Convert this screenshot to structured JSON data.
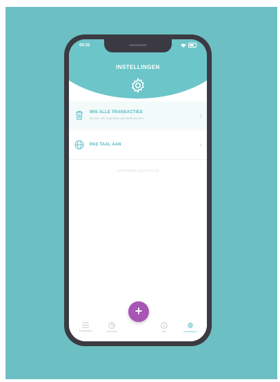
{
  "status_bar": {
    "time": "00:32"
  },
  "header": {
    "title": "INSTELLINGEN"
  },
  "settings": [
    {
      "title": "WIS ALLE TRANSACTIES",
      "subtitle": "Dit kan niet ongedaan gemaakt worden",
      "icon": "trash-icon"
    },
    {
      "title": "PAS TAAL AAN",
      "subtitle": "",
      "icon": "globe-icon"
    }
  ],
  "version": "APPVERSIE 2022 (V4.0.0)",
  "tabs": [
    {
      "label": "Transacties",
      "icon": "list-icon"
    },
    {
      "label": "Overzicht",
      "icon": "pie-chart-icon"
    },
    {
      "label": "Info",
      "icon": "info-icon"
    },
    {
      "label": "Instellingen",
      "icon": "gear-icon"
    }
  ],
  "colors": {
    "backdrop": "#6cbfc2",
    "accent": "#6cc5c9",
    "fab": "#a855b5",
    "phone_frame": "#3b3a42"
  }
}
